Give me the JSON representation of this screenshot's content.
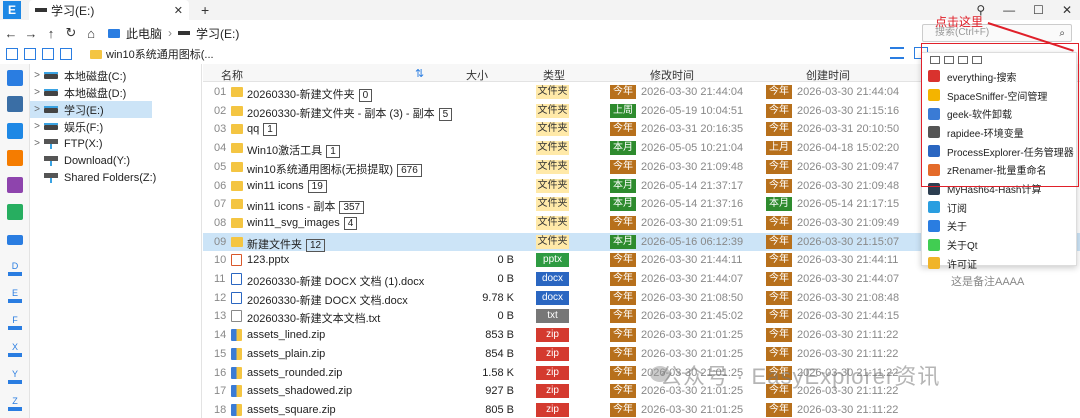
{
  "app": {
    "logo_letter": "E",
    "tab_label": "学习(E:)",
    "tab_close": "✕",
    "new_tab": "+"
  },
  "window": {
    "pin": "⚲",
    "minimize": "—",
    "maximize": "☐",
    "close": "✕"
  },
  "address": {
    "pc": "此电脑",
    "sep": "›",
    "drive": "学习(E:)",
    "search_placeholder": "搜索(Ctrl+F)"
  },
  "toolbar": {
    "path": "win10系统通用图标(..."
  },
  "tree": [
    {
      "label": "本地磁盘(C:)",
      "arrow": ">",
      "kind": "drive"
    },
    {
      "label": "本地磁盘(D:)",
      "arrow": ">",
      "kind": "drive"
    },
    {
      "label": "学习(E:)",
      "arrow": ">",
      "kind": "drive",
      "selected": true
    },
    {
      "label": "娱乐(F:)",
      "arrow": ">",
      "kind": "drive"
    },
    {
      "label": "FTP(X:)",
      "arrow": ">",
      "kind": "net"
    },
    {
      "label": "Download(Y:)",
      "arrow": "",
      "kind": "net"
    },
    {
      "label": "Shared Folders(Z:)",
      "arrow": "",
      "kind": "net"
    }
  ],
  "dock_drives": [
    "D",
    "E",
    "F",
    "X",
    "Y",
    "Z"
  ],
  "columns": {
    "name": "名称",
    "sort": "⇅",
    "size": "大小",
    "type": "类型",
    "modified": "修改时间",
    "created": "创建时间"
  },
  "rows": [
    {
      "idx": "01",
      "icon": "folder",
      "name": "20260330-新建文件夹",
      "count": "0",
      "size": "",
      "type": "文件夹",
      "tcls": "folder",
      "mtag": "今年",
      "mtcls": "today",
      "mtime": "2026-03-30 21:44:04",
      "ctag": "今年",
      "ctcls": "today",
      "ctime": "2026-03-30 21:44:04",
      "note": ""
    },
    {
      "idx": "02",
      "icon": "folder",
      "name": "20260330-新建文件夹 - 副本 (3) - 副本",
      "count": "5",
      "size": "",
      "type": "文件夹",
      "tcls": "folder",
      "mtag": "上周",
      "mtcls": "week",
      "mtime": "2026-05-19 10:04:51",
      "ctag": "今年",
      "ctcls": "today",
      "ctime": "2026-03-30 21:15:16",
      "note": ""
    },
    {
      "idx": "03",
      "icon": "folder",
      "name": "qq",
      "count": "1",
      "size": "",
      "type": "文件夹",
      "tcls": "folder",
      "mtag": "今年",
      "mtcls": "today",
      "mtime": "2026-03-31 20:16:35",
      "ctag": "今年",
      "ctcls": "today",
      "ctime": "2026-03-31 20:10:50",
      "note": ""
    },
    {
      "idx": "04",
      "icon": "folder",
      "name": "Win10激活工具",
      "count": "1",
      "size": "",
      "type": "文件夹",
      "tcls": "folder",
      "mtag": "本月",
      "mtcls": "month",
      "mtime": "2026-05-05 10:21:04",
      "ctag": "上月",
      "ctcls": "today",
      "ctime": "2026-04-18 15:02:20",
      "note": ""
    },
    {
      "idx": "05",
      "icon": "folder",
      "name": "win10系统通用图标(无损提取)",
      "count": "676",
      "size": "",
      "type": "文件夹",
      "tcls": "folder",
      "mtag": "今年",
      "mtcls": "today",
      "mtime": "2026-03-30 21:09:48",
      "ctag": "今年",
      "ctcls": "today",
      "ctime": "2026-03-30 21:09:47",
      "note": ""
    },
    {
      "idx": "06",
      "icon": "folder",
      "name": "win11 icons",
      "count": "19",
      "size": "",
      "type": "文件夹",
      "tcls": "folder",
      "mtag": "本月",
      "mtcls": "month",
      "mtime": "2026-05-14 21:37:17",
      "ctag": "今年",
      "ctcls": "today",
      "ctime": "2026-03-30 21:09:48",
      "note": ""
    },
    {
      "idx": "07",
      "icon": "folder",
      "name": "win11 icons - 副本",
      "count": "357",
      "size": "",
      "type": "文件夹",
      "tcls": "folder",
      "mtag": "本月",
      "mtcls": "month",
      "mtime": "2026-05-14 21:37:16",
      "ctag": "本月",
      "ctcls": "month",
      "ctime": "2026-05-14 21:17:15",
      "note": ""
    },
    {
      "idx": "08",
      "icon": "folder",
      "name": "win11_svg_images",
      "count": "4",
      "size": "",
      "type": "文件夹",
      "tcls": "folder",
      "mtag": "今年",
      "mtcls": "today",
      "mtime": "2026-03-30 21:09:51",
      "ctag": "今年",
      "ctcls": "today",
      "ctime": "2026-03-30 21:09:49",
      "note": ""
    },
    {
      "idx": "09",
      "icon": "folder",
      "name": "新建文件夹",
      "count": "12",
      "size": "",
      "type": "文件夹",
      "tcls": "folder",
      "mtag": "本月",
      "mtcls": "month",
      "mtime": "2026-05-16 06:12:39",
      "ctag": "今年",
      "ctcls": "today",
      "ctime": "2026-03-30 21:15:07",
      "note": "",
      "selected": true
    },
    {
      "idx": "10",
      "icon": "pptx",
      "name": "123.pptx",
      "count": "",
      "size": "0 B",
      "type": "pptx",
      "tcls": "pptx",
      "mtag": "今年",
      "mtcls": "today",
      "mtime": "2026-03-30 21:44:11",
      "ctag": "今年",
      "ctcls": "today",
      "ctime": "2026-03-30 21:44:11",
      "note": ""
    },
    {
      "idx": "11",
      "icon": "docx",
      "name": "20260330-新建 DOCX 文档 (1).docx",
      "count": "",
      "size": "0 B",
      "type": "docx",
      "tcls": "docx",
      "mtag": "今年",
      "mtcls": "today",
      "mtime": "2026-03-30 21:44:07",
      "ctag": "今年",
      "ctcls": "today",
      "ctime": "2026-03-30 21:44:07",
      "note": "这是备注AAAA"
    },
    {
      "idx": "12",
      "icon": "docx",
      "name": "20260330-新建 DOCX 文档.docx",
      "count": "",
      "size": "9.78 K",
      "type": "docx",
      "tcls": "docx",
      "mtag": "今年",
      "mtcls": "today",
      "mtime": "2026-03-30 21:08:50",
      "ctag": "今年",
      "ctcls": "today",
      "ctime": "2026-03-30 21:08:48",
      "note": ""
    },
    {
      "idx": "13",
      "icon": "txt",
      "name": "20260330-新建文本文档.txt",
      "count": "",
      "size": "0 B",
      "type": "txt",
      "tcls": "txt",
      "mtag": "今年",
      "mtcls": "today",
      "mtime": "2026-03-30 21:45:02",
      "ctag": "今年",
      "ctcls": "today",
      "ctime": "2026-03-30 21:44:15",
      "note": ""
    },
    {
      "idx": "14",
      "icon": "zip",
      "name": "assets_lined.zip",
      "count": "",
      "size": "853 B",
      "type": "zip",
      "tcls": "zip",
      "mtag": "今年",
      "mtcls": "today",
      "mtime": "2026-03-30 21:01:25",
      "ctag": "今年",
      "ctcls": "today",
      "ctime": "2026-03-30 21:11:22",
      "note": ""
    },
    {
      "idx": "15",
      "icon": "zip",
      "name": "assets_plain.zip",
      "count": "",
      "size": "854 B",
      "type": "zip",
      "tcls": "zip",
      "mtag": "今年",
      "mtcls": "today",
      "mtime": "2026-03-30 21:01:25",
      "ctag": "今年",
      "ctcls": "today",
      "ctime": "2026-03-30 21:11:22",
      "note": ""
    },
    {
      "idx": "16",
      "icon": "zip",
      "name": "assets_rounded.zip",
      "count": "",
      "size": "1.58 K",
      "type": "zip",
      "tcls": "zip",
      "mtag": "今年",
      "mtcls": "today",
      "mtime": "2026-03-30 21:01:25",
      "ctag": "今年",
      "ctcls": "today",
      "ctime": "2026-03-30 21:11:22",
      "note": ""
    },
    {
      "idx": "17",
      "icon": "zip",
      "name": "assets_shadowed.zip",
      "count": "",
      "size": "927 B",
      "type": "zip",
      "tcls": "zip",
      "mtag": "今年",
      "mtcls": "today",
      "mtime": "2026-03-30 21:01:25",
      "ctag": "今年",
      "ctcls": "today",
      "ctime": "2026-03-30 21:11:22",
      "note": ""
    },
    {
      "idx": "18",
      "icon": "zip",
      "name": "assets_square.zip",
      "count": "",
      "size": "805 B",
      "type": "zip",
      "tcls": "zip",
      "mtag": "今年",
      "mtcls": "today",
      "mtime": "2026-03-30 21:01:25",
      "ctag": "今年",
      "ctcls": "today",
      "ctime": "2026-03-30 21:11:22",
      "note": ""
    }
  ],
  "menu": {
    "items": [
      {
        "label": "everything-搜索",
        "icon": "magnifier-icon",
        "color": "#d9322e"
      },
      {
        "label": "SpaceSniffer-空间管理",
        "icon": "puzzle-icon",
        "color": "#f4b400"
      },
      {
        "label": "geek-软件卸载",
        "icon": "geek-icon",
        "color": "#3a7bd5"
      },
      {
        "label": "rapidee-环境变量",
        "icon": "rapidee-icon",
        "color": "#555555"
      },
      {
        "label": "ProcessExplorer-任务管理器",
        "icon": "process-icon",
        "color": "#2a66c1"
      },
      {
        "label": "zRenamer-批量重命名",
        "icon": "rename-icon",
        "color": "#e46b2a"
      },
      {
        "label": "MyHash64-Hash计算",
        "icon": "hash-icon",
        "color": "#2c3e50"
      },
      {
        "label": "订阅",
        "icon": "subscribe-icon",
        "color": "#2a9ee0"
      },
      {
        "label": "关于",
        "icon": "info-icon",
        "color": "#2a7de1"
      },
      {
        "label": "关于Qt",
        "icon": "qt-icon",
        "color": "#41cd52"
      },
      {
        "label": "许可证",
        "icon": "license-icon",
        "color": "#f0b429"
      }
    ]
  },
  "annotation": {
    "callout": "点击这里",
    "color": "#e0202a"
  },
  "watermark": "公众号 · EasyExplorer资讯"
}
